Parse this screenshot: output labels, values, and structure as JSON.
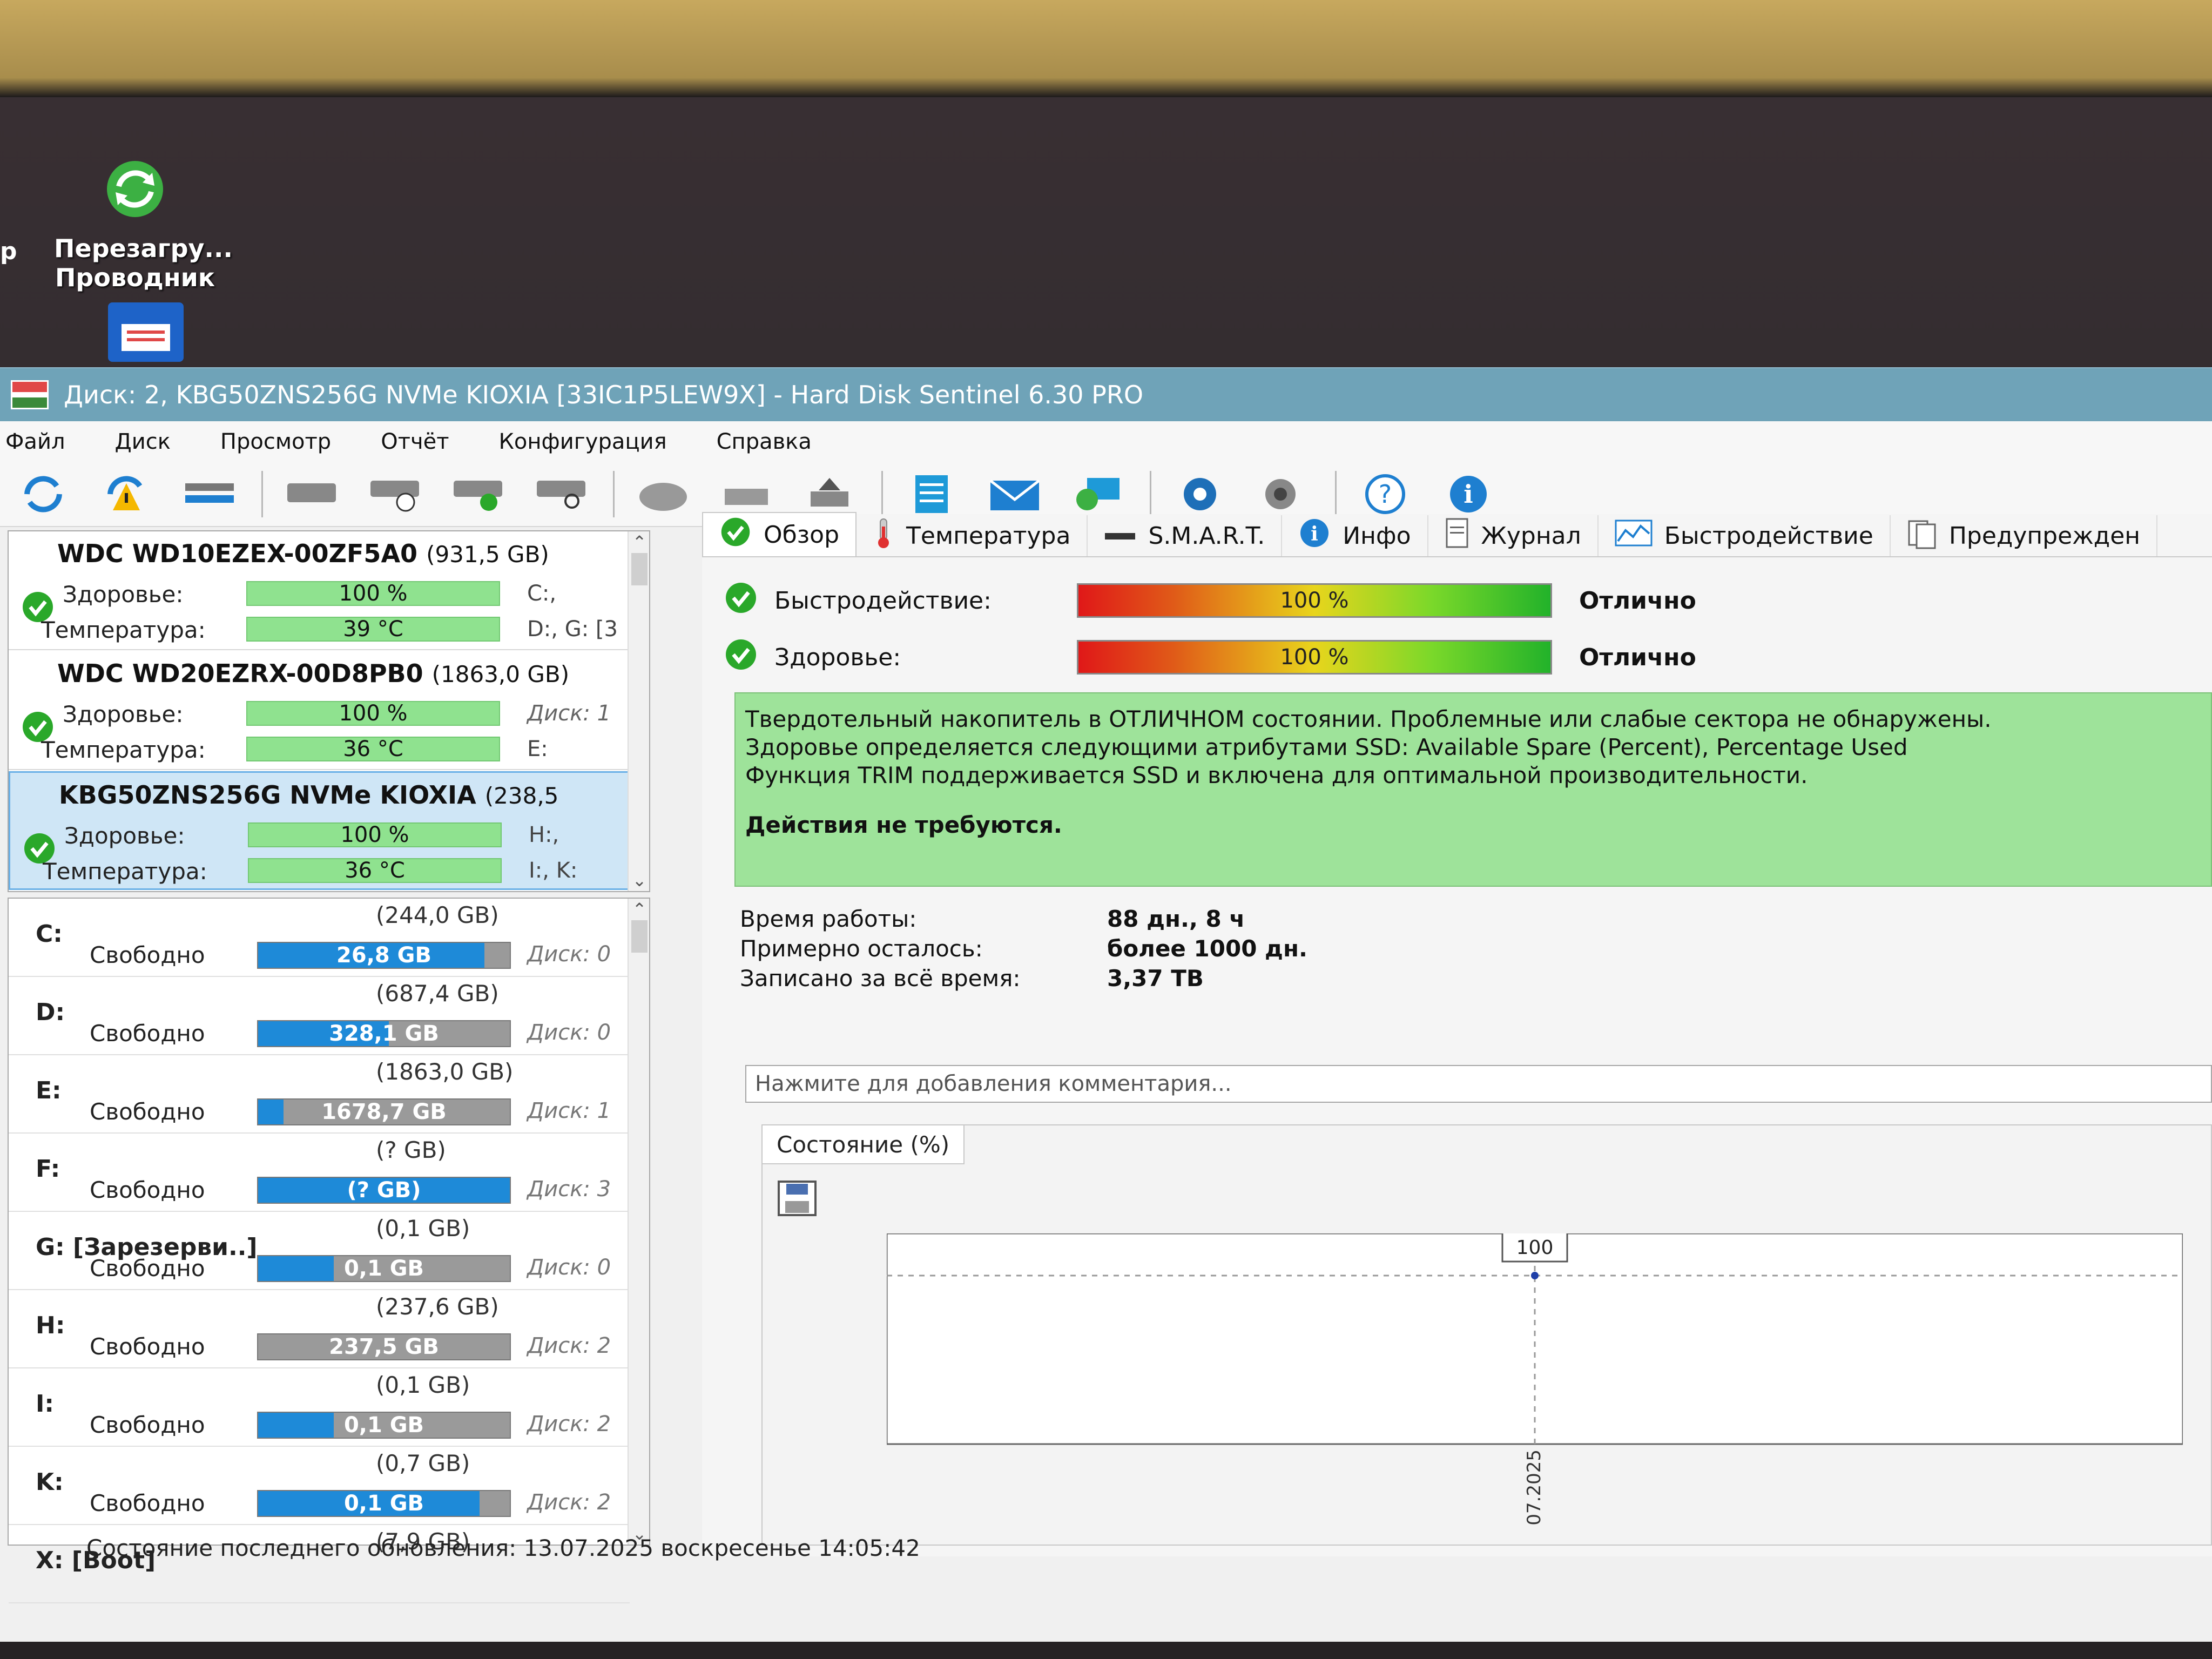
{
  "desktop": {
    "icons": [
      {
        "label_line1": "Перезагру...",
        "label_line2": "Проводник",
        "icon": "refresh-icon"
      },
      {
        "label_line1": "",
        "label_line2": "",
        "icon": "floppy-icon"
      }
    ],
    "partial_left_text": "р"
  },
  "window": {
    "title": "Диск: 2, KBG50ZNS256G NVMe KIOXIA [33IC1P5LEW9X]  -  Hard Disk Sentinel 6.30 PRO"
  },
  "menu": [
    "Файл",
    "Диск",
    "Просмотр",
    "Отчёт",
    "Конфигурация",
    "Справка"
  ],
  "toolbar": [
    "refresh-icon",
    "refresh-warning-icon",
    "disk-list-icon",
    "hdd-icon",
    "hdd-clock-icon",
    "hdd-check-icon",
    "hdd-search-icon",
    "disk-surface-icon",
    "disk-tools-icon",
    "disk-eject-icon",
    "report-icon",
    "mail-icon",
    "network-icon",
    "gear-icon",
    "speaker-icon",
    "help-icon",
    "info-icon"
  ],
  "disks": [
    {
      "name": "WDC WD10EZEX-00ZF5A0",
      "capacity": "(931,5 GB)",
      "health_label": "Здоровье:",
      "health": "100 %",
      "temp_label": "Температура:",
      "temp": "39 °C",
      "vol1": "C:,",
      "vol2": "D:, G: [3",
      "vol_italic": false
    },
    {
      "name": "WDC WD20EZRX-00D8PB0",
      "capacity": "(1863,0 GB)",
      "health_label": "Здоровье:",
      "health": "100 %",
      "temp_label": "Температура:",
      "temp": "36 °C",
      "vol1": "Диск: 1",
      "vol2": "E:",
      "vol_italic": true
    },
    {
      "name": "KBG50ZNS256G NVMe KIOXIA",
      "capacity": "(238,5",
      "health_label": "Здоровье:",
      "health": "100 %",
      "temp_label": "Температура:",
      "temp": "36 °C",
      "vol1": "H:,",
      "vol2": "I:, K:",
      "vol_italic": false
    }
  ],
  "volumes": [
    {
      "letter": "C:",
      "size": "(244,0 GB)",
      "free_label": "Свободно",
      "free": "26,8 GB",
      "fill": 0.9,
      "disk": "Диск: 0"
    },
    {
      "letter": "D:",
      "size": "(687,4 GB)",
      "free_label": "Свободно",
      "free": "328,1 GB",
      "fill": 0.52,
      "disk": "Диск: 0"
    },
    {
      "letter": "E:",
      "size": "(1863,0 GB)",
      "free_label": "Свободно",
      "free": "1678,7 GB",
      "fill": 0.1,
      "disk": "Диск: 1"
    },
    {
      "letter": "F:",
      "size": "(? GB)",
      "free_label": "Свободно",
      "free": "(? GB)",
      "fill": 1.0,
      "disk": "Диск: 3"
    },
    {
      "letter": "G: [Зарезерви..]",
      "size": "(0,1 GB)",
      "free_label": "Свободно",
      "free": "0,1 GB",
      "fill": 0.3,
      "disk": "Диск: 0"
    },
    {
      "letter": "H:",
      "size": "(237,6 GB)",
      "free_label": "Свободно",
      "free": "237,5 GB",
      "fill": 0.0,
      "disk": "Диск: 2"
    },
    {
      "letter": "I:",
      "size": "(0,1 GB)",
      "free_label": "Свободно",
      "free": "0,1 GB",
      "fill": 0.3,
      "disk": "Диск: 2"
    },
    {
      "letter": "K:",
      "size": "(0,7 GB)",
      "free_label": "Свободно",
      "free": "0,1 GB",
      "fill": 0.88,
      "disk": "Диск: 2"
    },
    {
      "letter": "X: [Boot]",
      "size": "(7,9 GB)",
      "free_label": "",
      "free": "",
      "fill": 0,
      "disk": ""
    }
  ],
  "tabs": [
    {
      "label": "Обзор",
      "icon": "check-icon"
    },
    {
      "label": "Температура",
      "icon": "thermometer-icon"
    },
    {
      "label": "S.M.A.R.T.",
      "icon": "smart-icon"
    },
    {
      "label": "Инфо",
      "icon": "info-icon"
    },
    {
      "label": "Журнал",
      "icon": "document-icon"
    },
    {
      "label": "Быстродействие",
      "icon": "performance-icon"
    },
    {
      "label": "Предупрежден",
      "icon": "alerts-icon"
    }
  ],
  "overview": {
    "performance_label": "Быстродействие:",
    "performance": "100 %",
    "performance_verdict": "Отлично",
    "health_label": "Здоровье:",
    "health": "100 %",
    "health_verdict": "Отлично",
    "summary_lines": [
      "Твердотельный накопитель в ОТЛИЧНОМ состоянии. Проблемные или слабые сектора не обнаружены.",
      "Здоровье определяется следующими атрибутами SSD: Available Spare (Percent), Percentage Used",
      "Функция TRIM поддерживается SSD и включена для оптимальной производительности."
    ],
    "action": "Действия не требуются.",
    "uptime_label": "Время работы:",
    "uptime": "88 дн., 8 ч",
    "remaining_label": "Примерно осталось:",
    "remaining": "более 1000 дн.",
    "written_label": "Записано за всё время:",
    "written": "3,37 TB",
    "comment_placeholder": "Нажмите для добавления комментария...",
    "state_tab": "Состояние (%)"
  },
  "chart_data": {
    "type": "line",
    "title": "",
    "x": [
      "13.07.2025"
    ],
    "series": [
      {
        "values": [
          100
        ]
      }
    ],
    "y_tick": "100",
    "point_label": "100",
    "grid": true
  },
  "status": {
    "text": "Состояние последнего обновления: 13.07.2025 воскресенье 14:05:42"
  }
}
